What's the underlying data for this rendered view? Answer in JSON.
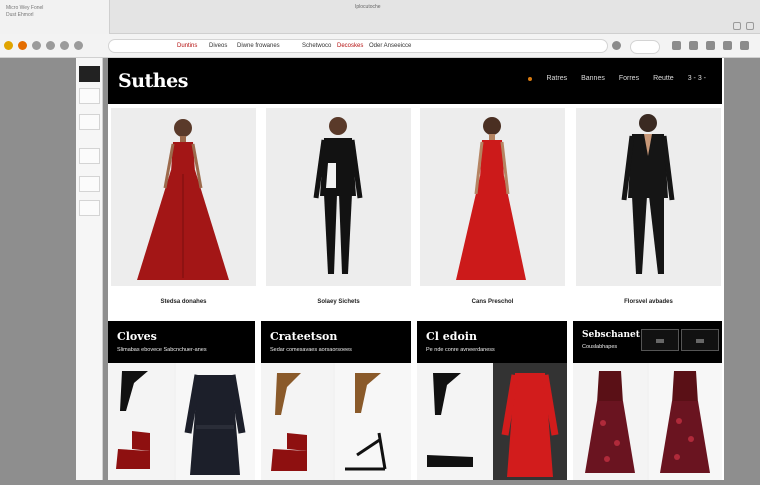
{
  "browser": {
    "tab_lines": [
      "Micro Wey Fonel",
      "Dust Ehmorl"
    ],
    "title": "Iplocutoche",
    "bookmarks": [
      "Duntins",
      "Diveos",
      "Diwne frowanes",
      "Schetwoco",
      "Decoskes",
      "Oder Anseeicce"
    ]
  },
  "side_panel": {
    "items": [
      "",
      "",
      "",
      "",
      "",
      ""
    ]
  },
  "site": {
    "logo": "Suthes",
    "nav": [
      "Ratres",
      "Bannes",
      "Forres",
      "Reutte",
      "3 - 3 -"
    ],
    "products": [
      {
        "caption": "Stedsa donahes",
        "color": "#a31616",
        "type": "gown"
      },
      {
        "caption": "Solaey Sichets",
        "color": "#121212",
        "type": "suit"
      },
      {
        "caption": "Cans Preschol",
        "color": "#cc1a1a",
        "type": "gown"
      },
      {
        "caption": "Florsvel avbades",
        "color": "#151515",
        "type": "suit"
      }
    ],
    "categories": [
      {
        "title": "Cloves",
        "sub": "Slimabas ebovece Sabcnchuer-anes"
      },
      {
        "title": "Crateetson",
        "sub": "Sedar comesavaes aorsaorsoees"
      },
      {
        "title": "Cl edoin",
        "sub": "Pe nde conre avneerdaness"
      },
      {
        "title": "Sebschanet",
        "sub": "Couslabhapes"
      }
    ]
  },
  "colors": {
    "accent": "#d87a10",
    "header_bg": "#000000"
  }
}
